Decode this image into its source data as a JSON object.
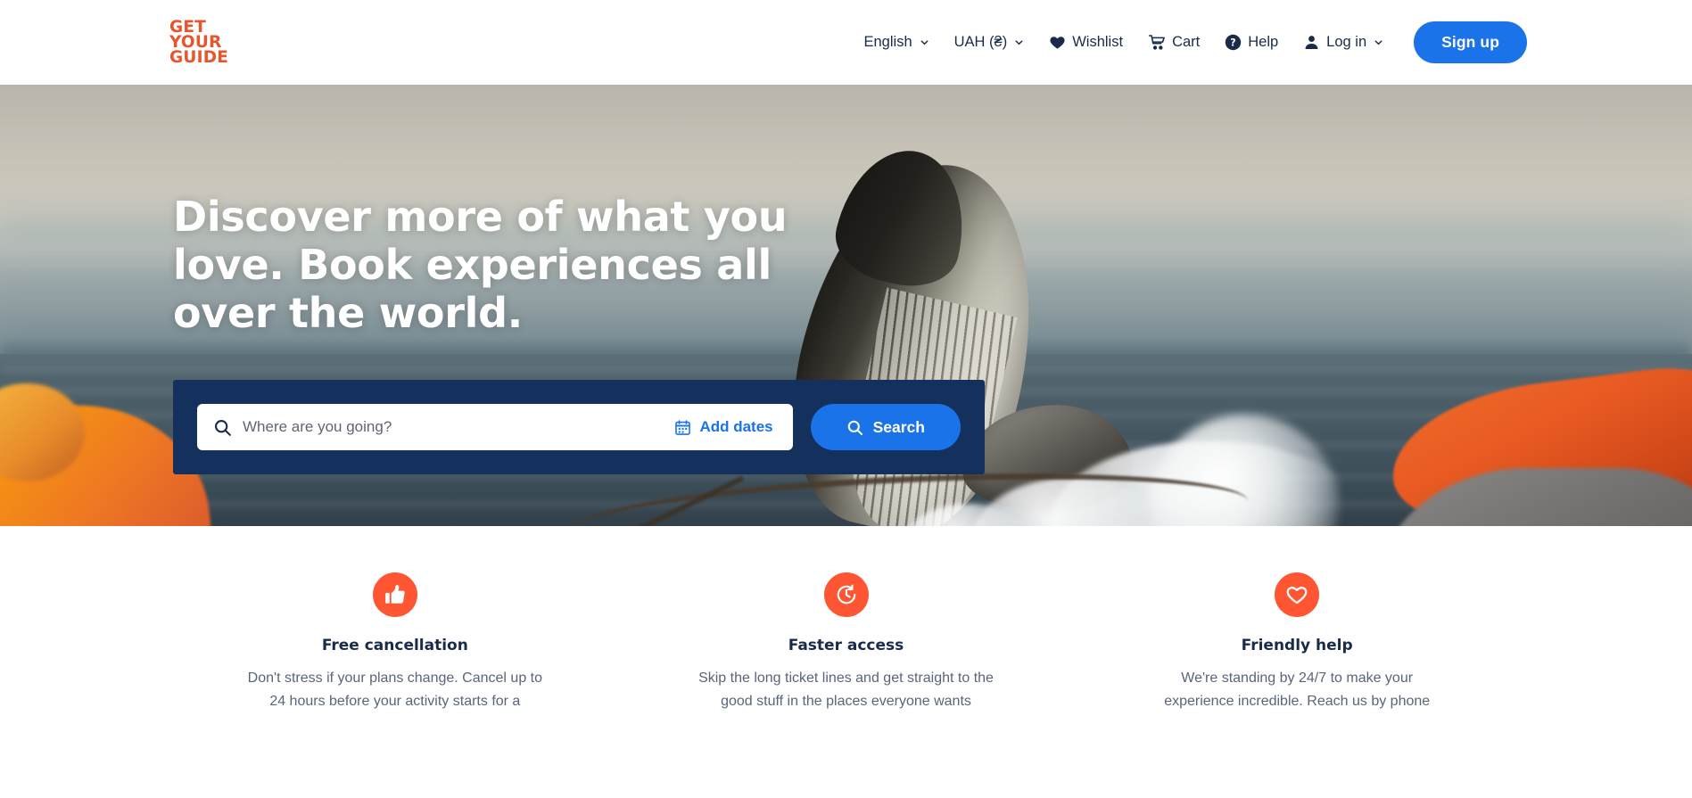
{
  "header": {
    "logo": {
      "line1": "GET",
      "line2": "YOUR",
      "line3": "GUIDE",
      "color": "#e8542b"
    },
    "nav": [
      {
        "label": "English",
        "icon": "chevron-down-icon",
        "has_caret": true
      },
      {
        "label": "UAH (₴)",
        "icon": "chevron-down-icon",
        "has_caret": true
      },
      {
        "label": "Wishlist",
        "icon": "heart-icon",
        "has_caret": false
      },
      {
        "label": "Cart",
        "icon": "cart-icon",
        "has_caret": false
      },
      {
        "label": "Help",
        "icon": "question-circle-icon",
        "has_caret": false
      },
      {
        "label": "Log in",
        "icon": "user-icon",
        "has_caret": true
      }
    ],
    "signup_label": "Sign up",
    "signup_color": "#1a73e8"
  },
  "hero": {
    "title": "Discover more of what you love. Book experiences all over the world.",
    "search": {
      "panel_color": "#14305c",
      "placeholder": "Where are you going?",
      "value": "",
      "search_icon": "search-icon",
      "add_dates_label": "Add dates",
      "calendar_icon": "calendar-icon",
      "button_label": "Search",
      "button_color": "#1a73e8"
    }
  },
  "features": {
    "accent_color": "#ff5533",
    "items": [
      {
        "icon": "thumbs-up-icon",
        "title": "Free cancellation",
        "desc": "Don't stress if your plans change. Cancel up to 24 hours before your activity starts for a"
      },
      {
        "icon": "clock-icon",
        "title": "Faster access",
        "desc": "Skip the long ticket lines and get straight to the good stuff in the places everyone wants"
      },
      {
        "icon": "heart-outline-icon",
        "title": "Friendly help",
        "desc": "We're standing by 24/7 to make your experience incredible. Reach us by phone"
      }
    ]
  }
}
